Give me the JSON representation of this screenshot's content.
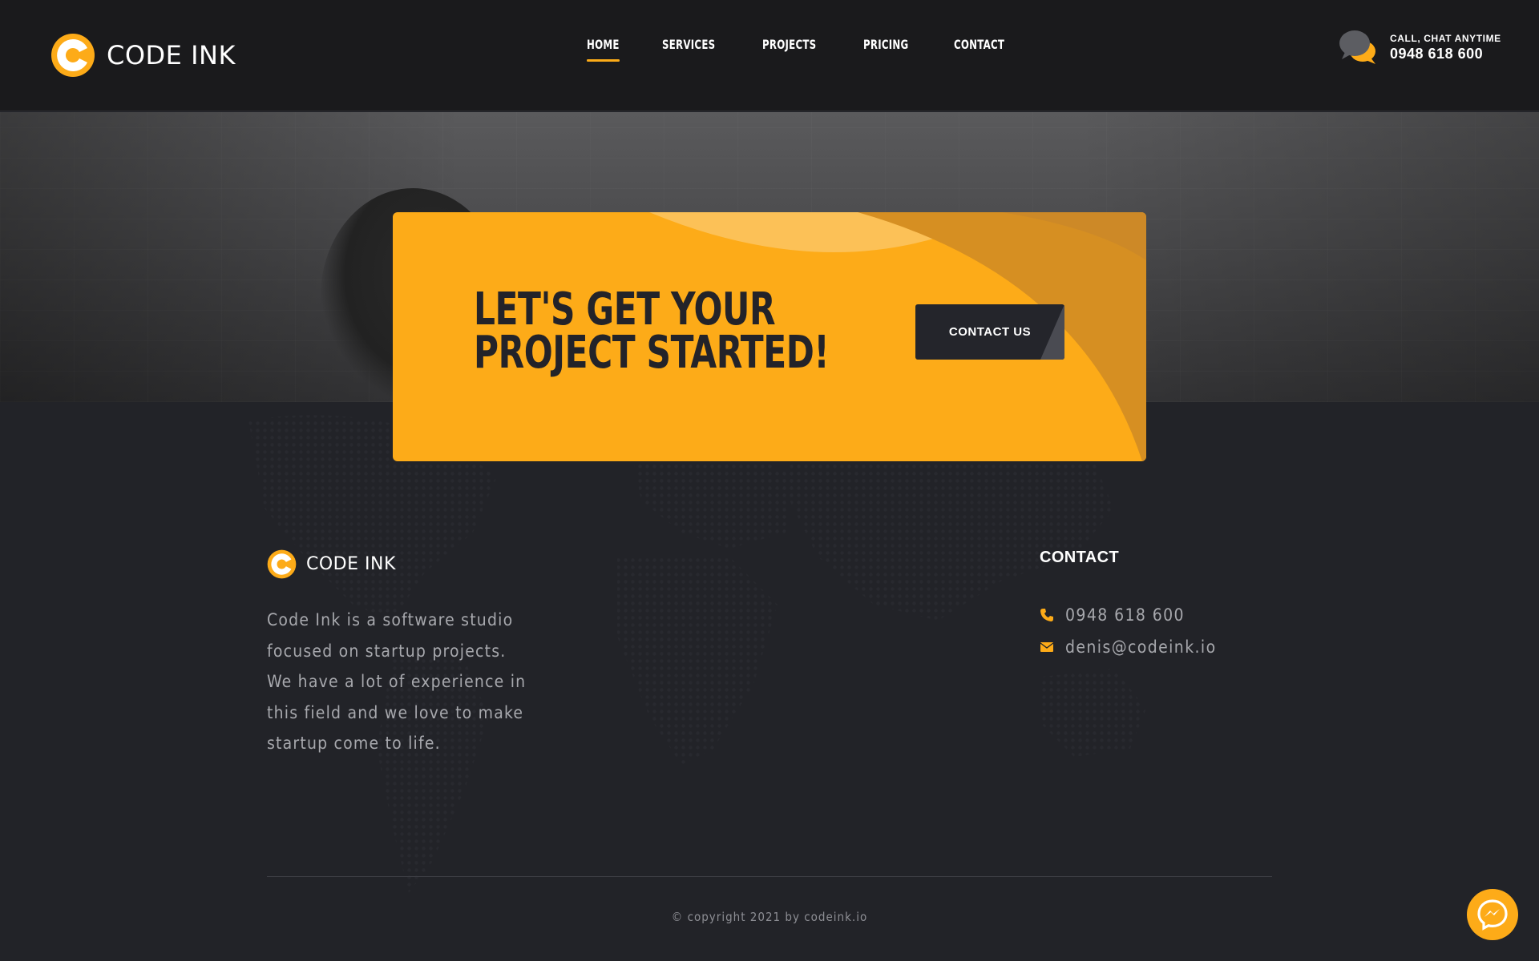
{
  "brand": {
    "name": "CODE INK",
    "accent": "#fdab18",
    "dark": "#232329"
  },
  "header": {
    "nav": [
      {
        "label": "HOME",
        "active": true
      },
      {
        "label": "SERVICES",
        "active": false
      },
      {
        "label": "PROJECTS",
        "active": false
      },
      {
        "label": "PRICING",
        "active": false
      },
      {
        "label": "CONTACT",
        "active": false
      }
    ],
    "contact": {
      "icon": "chat-bubbles-icon",
      "label": "CALL, CHAT ANYTIME",
      "phone": "0948 618 600"
    }
  },
  "cta": {
    "title": "LET'S GET YOUR PROJECT STARTED!",
    "button_label": "CONTACT US"
  },
  "footer": {
    "brand_name": "CODE INK",
    "description": "Code Ink is a software studio focused on startup projects. We have a lot of experience in this field and we love to make startup come to life.",
    "contact_heading": "CONTACT",
    "phone": {
      "icon": "phone-icon",
      "value": "0948 618 600"
    },
    "email": {
      "icon": "envelope-icon",
      "value": "denis@codeink.io"
    },
    "copyright": "© copyright 2021 by codeink.io"
  },
  "widgets": {
    "messenger_icon": "messenger-icon"
  }
}
